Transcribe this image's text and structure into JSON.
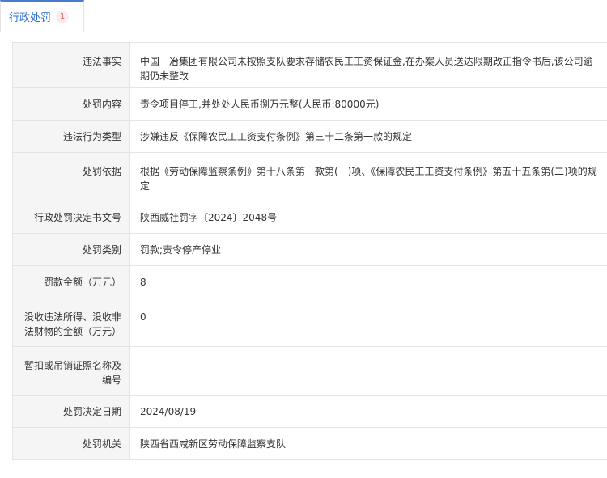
{
  "tab": {
    "label": "行政处罚",
    "count": "1"
  },
  "rows": [
    {
      "label": "违法事实",
      "value": "中国一冶集团有限公司未按照支队要求存储农民工工资保证金,在办案人员送达限期改正指令书后,该公司逾期仍未整改"
    },
    {
      "label": "处罚内容",
      "value": "责令项目停工,并处处人民币捌万元整(人民币:80000元)"
    },
    {
      "label": "违法行为类型",
      "value": "涉嫌违反《保障农民工工资支付条例》第三十二条第一款的规定"
    },
    {
      "label": "处罚依据",
      "value": "根据《劳动保障监察条例》第十八条第一款第(一)项、《保障农民工工资支付条例》第五十五条第(二)项的规定"
    },
    {
      "label": "行政处罚决定书文号",
      "value": "陕西威社罚字〔2024〕2048号"
    },
    {
      "label": "处罚类别",
      "value": "罚款;责令停产停业"
    },
    {
      "label": "罚款金额（万元）",
      "value": "8"
    },
    {
      "label": "没收违法所得、没收非法财物的金额（万元）",
      "value": "0"
    },
    {
      "label": "暂扣或吊销证照名称及编号",
      "value": "- -"
    },
    {
      "label": "处罚决定日期",
      "value": "2024/08/19"
    },
    {
      "label": "处罚机关",
      "value": "陕西省西咸新区劳动保障监察支队"
    }
  ]
}
